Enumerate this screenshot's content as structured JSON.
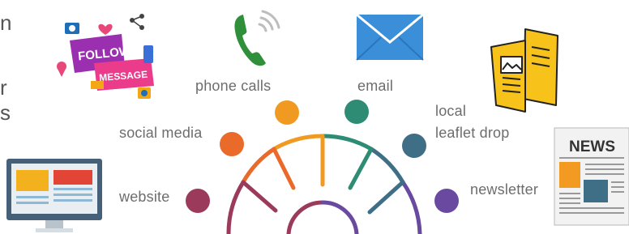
{
  "left_fragments": [
    "n",
    "r",
    "s"
  ],
  "channels": [
    {
      "label": "website",
      "color": "#9b3a5a"
    },
    {
      "label": "social media",
      "color": "#ea6a2a"
    },
    {
      "label": "phone calls",
      "color": "#f19a22"
    },
    {
      "label": "email",
      "color": "#2e8b74"
    },
    {
      "label": "local",
      "label2": "leaflet drop",
      "color": "#3f6f86"
    },
    {
      "label": "newsletter",
      "color": "#6a4aa0"
    }
  ],
  "icons": {
    "social_sticker_top": "FOLLOW",
    "social_sticker_bottom": "MESSAGE",
    "newspaper_title": "NEWS"
  },
  "colors": {
    "email_blue": "#3a8fd8",
    "phone_green": "#2f8f3a",
    "leaflet_yellow": "#f7c21a"
  }
}
